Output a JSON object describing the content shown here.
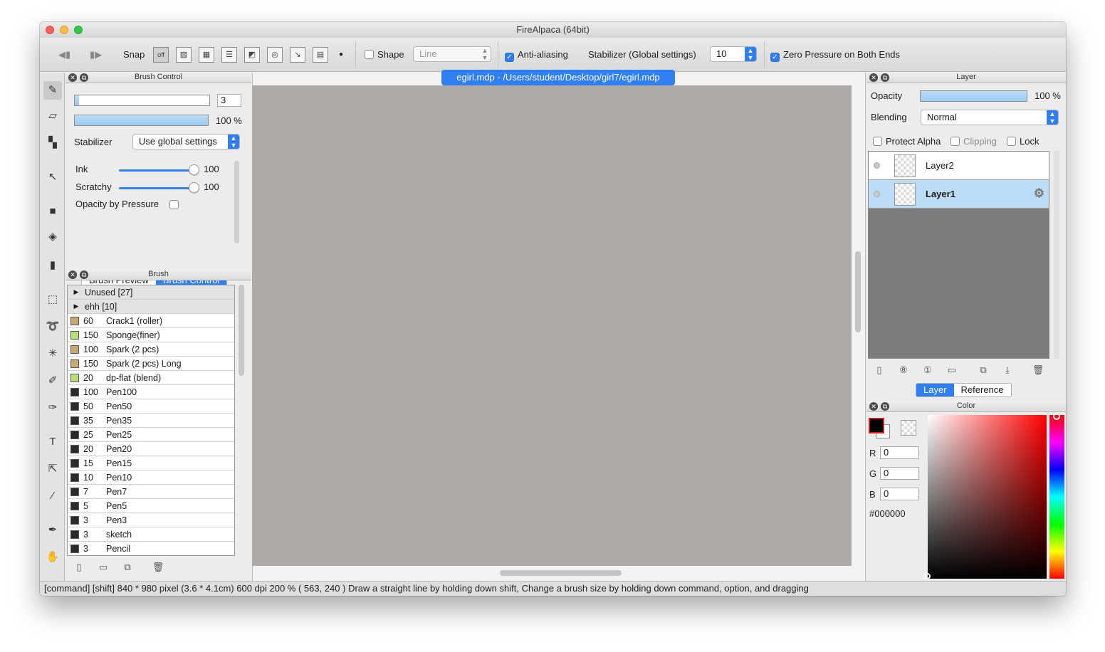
{
  "window": {
    "title": "FireAlpaca (64bit)"
  },
  "toolbar": {
    "snap_label": "Snap",
    "snap_off": "off",
    "shape_label": "Shape",
    "shape_value": "Line",
    "antialias_label": "Anti-aliasing",
    "stabilizer_label": "Stabilizer (Global settings)",
    "stabilizer_value": "10",
    "zero_pressure_label": "Zero Pressure on Both Ends"
  },
  "brush_control": {
    "title": "Brush Control",
    "size_value": "3",
    "opacity_value": "100 %",
    "opacity_level": 1.0,
    "stabilizer_label": "Stabilizer",
    "stabilizer_value": "Use global settings",
    "ink_label": "Ink",
    "ink_value": "100",
    "scratchy_label": "Scratchy",
    "scratchy_value": "100",
    "opacity_pressure_label": "Opacity by Pressure",
    "tab_preview": "Brush Preview",
    "tab_control": "Brush Control"
  },
  "brush_panel": {
    "title": "Brush",
    "groups": [
      {
        "label": "Unused [27]"
      },
      {
        "label": "ehh [10]"
      }
    ],
    "items": [
      {
        "size": "60",
        "name": "Crack1 (roller)",
        "color": "#c8a870"
      },
      {
        "size": "150",
        "name": "Sponge(finer)",
        "color": "#b9dd7a"
      },
      {
        "size": "100",
        "name": "Spark (2 pcs)",
        "color": "#c8a870"
      },
      {
        "size": "150",
        "name": "Spark (2 pcs) Long",
        "color": "#c8a870"
      },
      {
        "size": "20",
        "name": "dp-flat (blend)",
        "color": "#b9dd7a"
      },
      {
        "size": "100",
        "name": "Pen100",
        "color": "#2a2a2a"
      },
      {
        "size": "50",
        "name": "Pen50",
        "color": "#2a2a2a"
      },
      {
        "size": "35",
        "name": "Pen35",
        "color": "#2a2a2a"
      },
      {
        "size": "25",
        "name": "Pen25",
        "color": "#2a2a2a"
      },
      {
        "size": "20",
        "name": "Pen20",
        "color": "#2a2a2a"
      },
      {
        "size": "15",
        "name": "Pen15",
        "color": "#2a2a2a"
      },
      {
        "size": "10",
        "name": "Pen10",
        "color": "#2a2a2a"
      },
      {
        "size": "7",
        "name": "Pen7",
        "color": "#2a2a2a"
      },
      {
        "size": "5",
        "name": "Pen5",
        "color": "#2a2a2a"
      },
      {
        "size": "3",
        "name": "Pen3",
        "color": "#2a2a2a"
      },
      {
        "size": "3",
        "name": "sketch",
        "color": "#2a2a2a"
      },
      {
        "size": "3",
        "name": "Pencil",
        "color": "#2a2a2a"
      }
    ]
  },
  "document": {
    "tab": "egirl.mdp - /Users/student/Desktop/girl7/egirl.mdp"
  },
  "layer_panel": {
    "title": "Layer",
    "opacity_label": "Opacity",
    "opacity_value": "100 %",
    "opacity_level": 1.0,
    "blending_label": "Blending",
    "blending_value": "Normal",
    "protect_alpha": "Protect Alpha",
    "clipping": "Clipping",
    "lock": "Lock",
    "layers": [
      {
        "name": "Layer2",
        "selected": false
      },
      {
        "name": "Layer1",
        "selected": true
      }
    ],
    "tab_layer": "Layer",
    "tab_reference": "Reference"
  },
  "color_panel": {
    "title": "Color",
    "r_label": "R",
    "r_value": "0",
    "g_label": "G",
    "g_value": "0",
    "b_label": "B",
    "b_value": "0",
    "hex": "#000000",
    "primary_color": "#000000"
  },
  "statusbar": {
    "text": "[command] [shift]   840 * 980 pixel   (3.6 * 4.1cm)   600 dpi   200 %   ( 563, 240 )   Draw a straight line by holding down shift, Change a brush size by holding down command, option, and dragging"
  },
  "colors": {
    "accent": "#2f7ef2",
    "canvas_bg": "#aca9a7",
    "selected_row": "#bcdcf5"
  }
}
